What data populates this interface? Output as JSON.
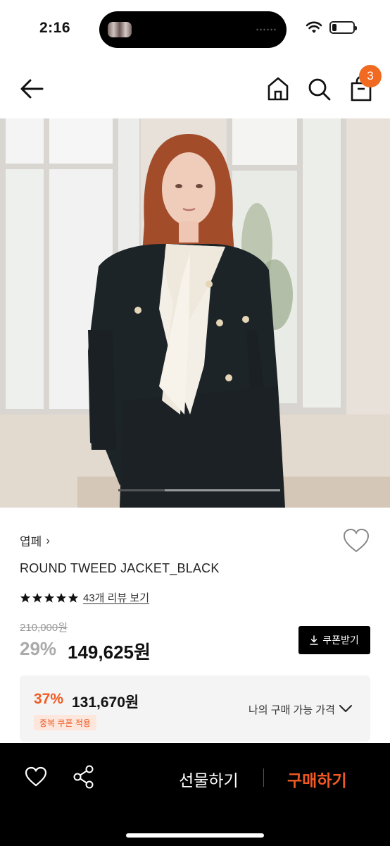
{
  "status_bar": {
    "time": "2:16",
    "battery_level": 0.2
  },
  "nav": {
    "back_icon": "arrow-left-icon",
    "home_icon": "home-icon",
    "search_icon": "search-icon",
    "bag_icon": "shopping-bag-icon",
    "cart_count": "3"
  },
  "hero": {
    "image_count_position": 1
  },
  "product": {
    "brand": "엽페",
    "brand_chevron": "›",
    "name": "ROUND TWEED JACKET_BLACK",
    "rating_stars": 5,
    "review_link": "43개 리뷰 보기",
    "original_price": "210,000원",
    "discount": "29%",
    "sale_price": "149,625원",
    "coupon_button": "쿠폰받기",
    "coupon_icon": "download-icon"
  },
  "my_price": {
    "discount": "37%",
    "price": "131,670원",
    "badge": "중복 쿠폰 적용",
    "label": "나의 구매 가능 가격",
    "chevron_icon": "chevron-down-icon"
  },
  "bottom_bar": {
    "heart_icon": "heart-icon",
    "share_icon": "share-icon",
    "gift_label": "선물하기",
    "buy_label": "구매하기"
  },
  "colors": {
    "accent": "#f05a22",
    "badge": "#f06a22",
    "bottom_bar": "#000000"
  }
}
